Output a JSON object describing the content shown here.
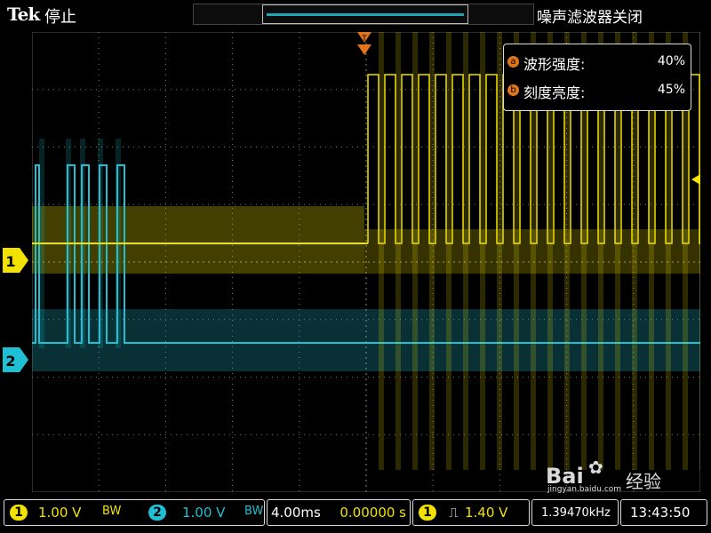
{
  "header": {
    "brand": "Tek",
    "acquisition_status": "停止",
    "noise_filter_status": "噪声滤波器关闭"
  },
  "measure_menu": {
    "items": [
      {
        "icon": "a",
        "label": "波形强度:",
        "value": "40%"
      },
      {
        "icon": "b",
        "label": "刻度亮度:",
        "value": "45%"
      }
    ]
  },
  "channels": [
    {
      "id": "1",
      "color": "#f2e200",
      "scale": "1.00 V",
      "bw_label": "BW"
    },
    {
      "id": "2",
      "color": "#1fc0d4",
      "scale": "1.00 V",
      "bw_label": "BW"
    }
  ],
  "horizontal": {
    "scale": "4.00ms",
    "position": "0.00000 s"
  },
  "trigger": {
    "source": "1",
    "slope_symbol": "⎍",
    "level": "1.40 V"
  },
  "status": {
    "frequency": "1.39470kHz",
    "time": "13:43:50"
  },
  "markers": {
    "ch1": "1",
    "ch2": "2",
    "trigger_pos": "T"
  },
  "watermark": {
    "brand": "Bai",
    "text": "经验",
    "url": "jingyan.baidu.com"
  },
  "colors": {
    "ch1": "#f2e200",
    "ch2": "#1fc0d4",
    "accent": "#e0751c"
  }
}
